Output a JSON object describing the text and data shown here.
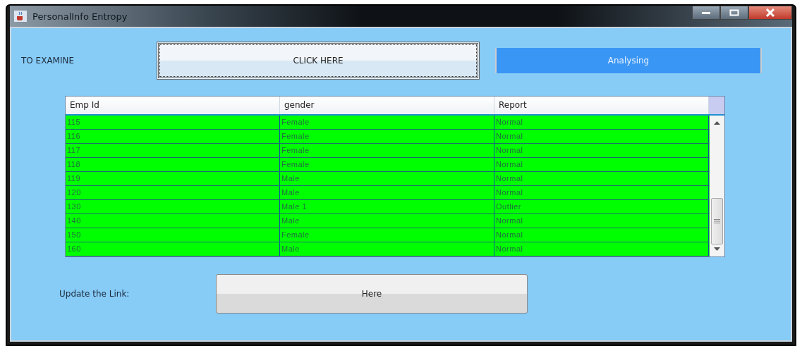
{
  "window": {
    "title": "PersonalInfo  Entropy"
  },
  "examine": {
    "label": "TO EXAMINE",
    "button": "CLICK HERE",
    "status": "Analysing"
  },
  "table": {
    "columns": [
      "Emp Id",
      "gender",
      "Report"
    ],
    "rows": [
      [
        "115",
        "Female",
        "Normal"
      ],
      [
        "116",
        "Female",
        "Normal"
      ],
      [
        "117",
        "Female",
        "Normal"
      ],
      [
        "118",
        "Female",
        "Normal"
      ],
      [
        "119",
        "Male",
        "Normal"
      ],
      [
        "120",
        "Male",
        "Normal"
      ],
      [
        "130",
        "Male 1",
        "Outlier"
      ],
      [
        "140",
        "Male",
        "Normal"
      ],
      [
        "150",
        "Female",
        "Normal"
      ],
      [
        "160",
        "Male",
        "Normal"
      ]
    ]
  },
  "update": {
    "label": "Update the Link:",
    "button": "Here"
  }
}
